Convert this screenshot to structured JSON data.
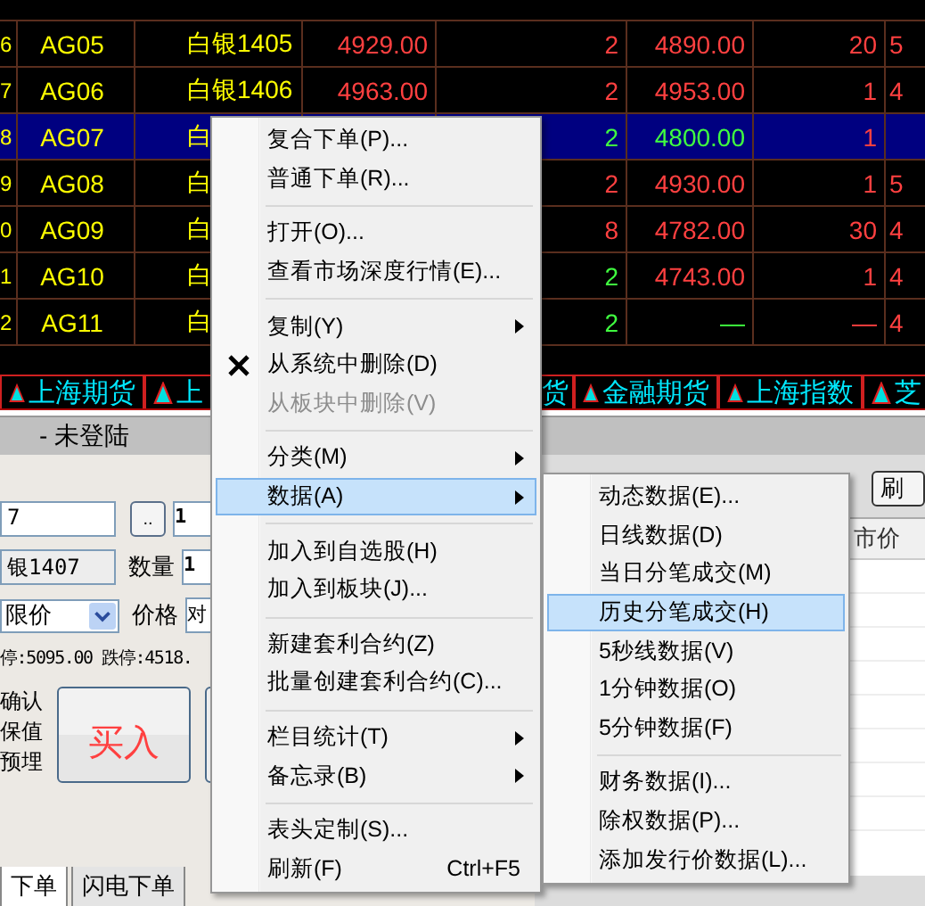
{
  "quote_table": {
    "rows": [
      {
        "num": "6",
        "code": "AG05",
        "name": "白银1405",
        "price": "4929.00",
        "price_up": true,
        "vol": "2",
        "vol_up": true,
        "price2": "4890.00",
        "price2_up": true,
        "qty": "20",
        "qty_up": true,
        "last": "5",
        "last_up": true,
        "selected": false
      },
      {
        "num": "7",
        "code": "AG06",
        "name": "白银1406",
        "price": "4963.00",
        "price_up": true,
        "vol": "2",
        "vol_up": true,
        "price2": "4953.00",
        "price2_up": true,
        "qty": "1",
        "qty_up": true,
        "last": "4",
        "last_up": true,
        "selected": false
      },
      {
        "num": "8",
        "code": "AG07",
        "name": "白",
        "vol": "2",
        "vol_up": false,
        "price2": "4800.00",
        "price2_up": false,
        "qty": "1",
        "qty_up": true,
        "selected": true
      },
      {
        "num": "9",
        "code": "AG08",
        "name": "白",
        "vol": "2",
        "vol_up": true,
        "price2": "4930.00",
        "price2_up": true,
        "qty": "1",
        "qty_up": true,
        "last": "5",
        "last_up": true,
        "selected": false
      },
      {
        "num": "0",
        "code": "AG09",
        "name": "白",
        "vol": "8",
        "vol_up": true,
        "price2": "4782.00",
        "price2_up": true,
        "qty": "30",
        "qty_up": true,
        "last": "4",
        "last_up": true,
        "selected": false
      },
      {
        "num": "1",
        "code": "AG10",
        "name": "白",
        "vol": "2",
        "vol_up": false,
        "price2": "4743.00",
        "price2_up": true,
        "qty": "1",
        "qty_up": true,
        "last": "4",
        "last_up": true,
        "selected": false
      },
      {
        "num": "2",
        "code": "AG11",
        "name": "白",
        "vol": "2",
        "vol_up": false,
        "price2": "—",
        "price2_up": false,
        "qty": "—",
        "qty_up": true,
        "last": "4",
        "last_up": true,
        "selected": false
      }
    ]
  },
  "market_tabs": [
    {
      "label": "上海期货",
      "kind": "full"
    },
    {
      "label": "上",
      "kind": "full"
    },
    {
      "label": "货",
      "kind": "cut"
    },
    {
      "label": "金融期货",
      "kind": "full"
    },
    {
      "label": "上海指数",
      "kind": "full"
    },
    {
      "label": "芝",
      "kind": "full"
    }
  ],
  "order_panel": {
    "title": "- 未登陆",
    "contract": "7",
    "browse_button": "..",
    "price_field": "1",
    "name_field": "银1407",
    "qty_label": "数量",
    "qty_field": "1",
    "order_type": "限价",
    "price_label": "价格",
    "price_value": "对",
    "limits": "停:5095.00 跌停:4518.",
    "options": [
      "确认",
      "保值",
      "预埋"
    ],
    "buy_button": "买入",
    "right_button": "刷",
    "right_column": "市价",
    "bottom_tabs": [
      {
        "label": "下单",
        "selected": true
      },
      {
        "label": "闪电下单",
        "selected": false
      }
    ]
  },
  "context_menu": {
    "items": [
      {
        "kind": "item",
        "label": "复合下单(P)..."
      },
      {
        "kind": "item",
        "label": "普通下单(R)..."
      },
      {
        "kind": "separator"
      },
      {
        "kind": "item",
        "label": "打开(O)..."
      },
      {
        "kind": "item",
        "label": "查看市场深度行情(E)..."
      },
      {
        "kind": "separator"
      },
      {
        "kind": "item",
        "label": "复制(Y)",
        "submenu": true
      },
      {
        "kind": "cross_item",
        "label": "从系统中删除(D)"
      },
      {
        "kind": "item",
        "label": "从板块中删除(V)",
        "disabled": true
      },
      {
        "kind": "separator"
      },
      {
        "kind": "item",
        "label": "分类(M)",
        "submenu": true
      },
      {
        "kind": "item",
        "label": "数据(A)",
        "submenu": true,
        "selected": true
      },
      {
        "kind": "separator"
      },
      {
        "kind": "item",
        "label": "加入到自选股(H)"
      },
      {
        "kind": "item",
        "label": "加入到板块(J)..."
      },
      {
        "kind": "separator"
      },
      {
        "kind": "item",
        "label": "新建套利合约(Z)"
      },
      {
        "kind": "item",
        "label": "批量创建套利合约(C)..."
      },
      {
        "kind": "separator"
      },
      {
        "kind": "item",
        "label": "栏目统计(T)",
        "submenu": true
      },
      {
        "kind": "item",
        "label": "备忘录(B)",
        "submenu": true
      },
      {
        "kind": "separator"
      },
      {
        "kind": "item",
        "label": "表头定制(S)..."
      },
      {
        "kind": "item",
        "label": "刷新(F)",
        "shortcut": "Ctrl+F5"
      }
    ]
  },
  "submenu": {
    "items": [
      {
        "kind": "item",
        "label": "动态数据(E)..."
      },
      {
        "kind": "item",
        "label": "日线数据(D)"
      },
      {
        "kind": "item",
        "label": "当日分笔成交(M)"
      },
      {
        "kind": "item",
        "label": "历史分笔成交(H)",
        "selected": true
      },
      {
        "kind": "item",
        "label": "5秒线数据(V)"
      },
      {
        "kind": "item",
        "label": "1分钟数据(O)"
      },
      {
        "kind": "item",
        "label": "5分钟数据(F)"
      },
      {
        "kind": "separator"
      },
      {
        "kind": "item",
        "label": "财务数据(I)..."
      },
      {
        "kind": "item",
        "label": "除权数据(P)..."
      },
      {
        "kind": "item",
        "label": "添加发行价数据(L)..."
      }
    ]
  }
}
